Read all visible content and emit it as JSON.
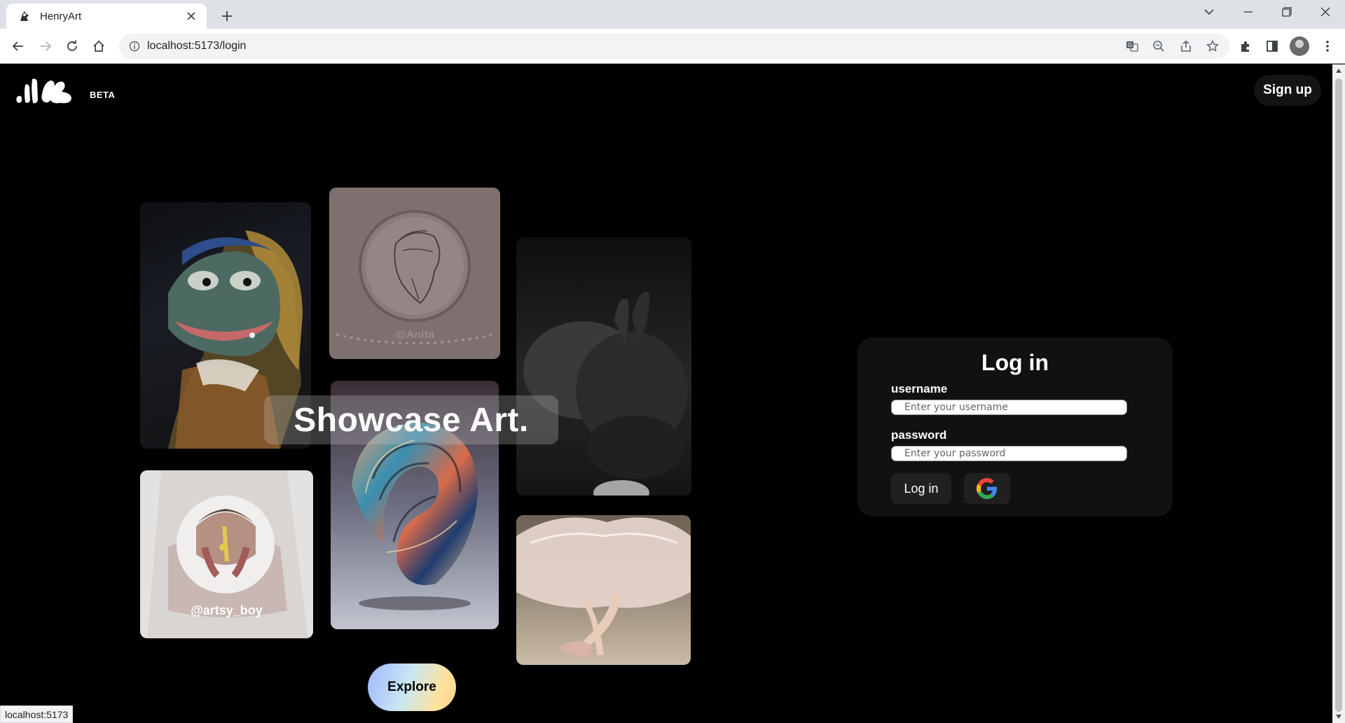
{
  "browser": {
    "tab_title": "HenryArt",
    "url": "localhost:5173/login",
    "status_text": "localhost:5173"
  },
  "header": {
    "beta_label": "BETA",
    "signup_label": "Sign up"
  },
  "hero": {
    "showcase_text": "Showcase Art.",
    "explore_label": "Explore",
    "cards": {
      "anita_handle": "@Anita",
      "artsy_handle": "@artsy_boy"
    }
  },
  "login": {
    "title": "Log in",
    "username_label": "username",
    "username_placeholder": "Enter your username",
    "username_value": "",
    "password_label": "password",
    "password_placeholder": "Enter your password",
    "password_value": "",
    "submit_label": "Log in",
    "google_icon": "google-icon"
  }
}
